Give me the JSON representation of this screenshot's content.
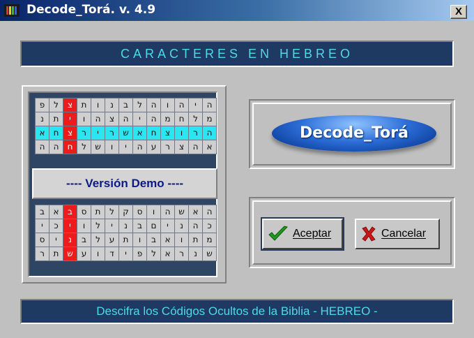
{
  "window": {
    "title": "Decode_Torá.  v. 4.9",
    "close_label": "X"
  },
  "header_banner": "CARACTERES EN HEBREO",
  "grid_top": [
    [
      "פ",
      "ל",
      "צ",
      "ת",
      "ו",
      "נ",
      "ב",
      "ל",
      "ה",
      "ו",
      "ה",
      "י",
      "ה"
    ],
    [
      "נ",
      "ת",
      "י",
      "ו",
      "ה",
      "צ",
      "ה",
      "י",
      "ה",
      "מ",
      "ח",
      "ל",
      "מ"
    ],
    [
      "א",
      "ח",
      "צ",
      "ר",
      "י",
      "ר",
      "ש",
      "א",
      "ח",
      "צ",
      "ו",
      "ר",
      "ה"
    ],
    [
      "ה",
      "ה",
      "ח",
      "ל",
      "ש",
      "ו",
      "י",
      "ה",
      "ע",
      "ר",
      "צ",
      "ה",
      "א"
    ]
  ],
  "grid_bottom": [
    [
      "ב",
      "א",
      "ב",
      "ס",
      "ת",
      "ל",
      "ק",
      "ס",
      "ו",
      "ה",
      "ש",
      "א",
      "ה"
    ],
    [
      "י",
      "כ",
      "י",
      "ו",
      "ל",
      "י",
      "נ",
      "ב",
      "ם",
      "י",
      "נ",
      "ה",
      "כ"
    ],
    [
      "ס",
      "י",
      "נ",
      "ב",
      "ל",
      "ע",
      "ת",
      "ו",
      "ב",
      "א",
      "ו",
      "ת",
      "מ"
    ],
    [
      "ר",
      "ת",
      "ש",
      "ע",
      "ו",
      "ד",
      "י",
      "פ",
      "ל",
      "א",
      "ר",
      "נ",
      "ש"
    ]
  ],
  "demo_label": "---- Versión Demo ----",
  "logo_text": "Decode_Torá",
  "buttons": {
    "ok_label": "Aceptar",
    "cancel_label": "Cancelar"
  },
  "footer_banner": "Descifra los Códigos Ocultos de la Biblia   - HEBREO -",
  "colors": {
    "highlight_cyan": "#29e6f0",
    "highlight_red": "#ee1b1b",
    "banner_bg": "#1e3a62",
    "banner_text": "#4fd8e8"
  }
}
